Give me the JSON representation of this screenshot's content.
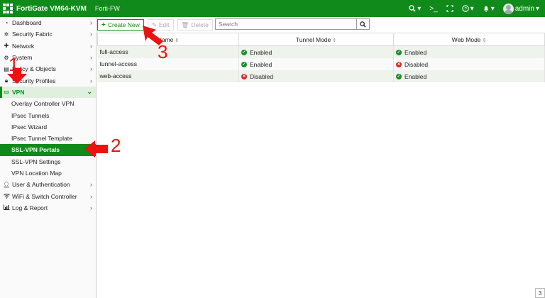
{
  "header": {
    "app_title": "FortiGate VM64-KVM",
    "hostname": "Forti-FW",
    "user": "admin",
    "icons": [
      "search-icon",
      "terminal-icon",
      "fullscreen-icon",
      "help-icon",
      "bell-icon",
      "user-icon"
    ]
  },
  "sidebar": {
    "items": [
      {
        "label": "Dashboard",
        "icon": "dashboard-icon"
      },
      {
        "label": "Security Fabric",
        "icon": "fabric-icon"
      },
      {
        "label": "Network",
        "icon": "network-icon"
      },
      {
        "label": "System",
        "icon": "gear-icon"
      },
      {
        "label": "Policy & Objects",
        "icon": "policy-icon"
      },
      {
        "label": "Security Profiles",
        "icon": "lock-icon"
      },
      {
        "label": "VPN",
        "icon": "monitor-icon"
      },
      {
        "label": "User & Authentication",
        "icon": "user-icon"
      },
      {
        "label": "WiFi & Switch Controller",
        "icon": "wifi-icon"
      },
      {
        "label": "Log & Report",
        "icon": "chart-icon"
      }
    ],
    "vpn_subitems": [
      "Overlay Controller VPN",
      "IPsec Tunnels",
      "IPsec Wizard",
      "IPsec Tunnel Template",
      "SSL-VPN Portals",
      "SSL-VPN Settings",
      "VPN Location Map"
    ]
  },
  "toolbar": {
    "create_label": "Create New",
    "edit_label": "Edit",
    "delete_label": "Delete",
    "search_placeholder": "Search"
  },
  "table": {
    "columns": [
      "Name",
      "Tunnel Mode",
      "Web Mode"
    ],
    "rows": [
      {
        "name": "full-access",
        "tunnel": "Enabled",
        "web": "Enabled"
      },
      {
        "name": "tunnel-access",
        "tunnel": "Enabled",
        "web": "Disabled"
      },
      {
        "name": "web-access",
        "tunnel": "Disabled",
        "web": "Enabled"
      }
    ]
  },
  "annotations": [
    "1",
    "2",
    "3"
  ],
  "page_indicator": "3",
  "colors": {
    "brand_green": "#108a1a",
    "annotation_red": "#ee1111",
    "enabled_green": "#1a8d2a",
    "disabled_red": "#d32a2a"
  }
}
